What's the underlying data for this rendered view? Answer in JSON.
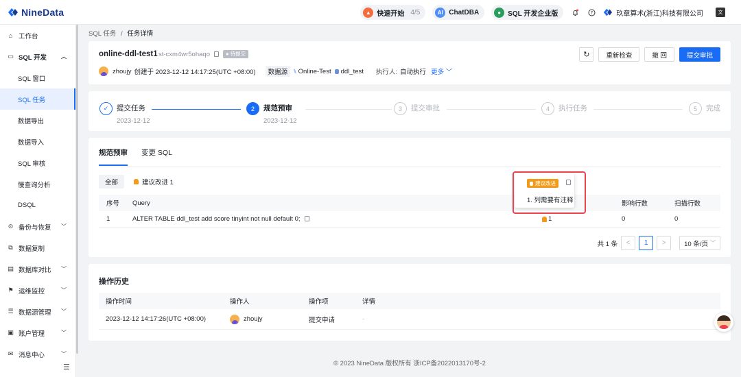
{
  "brand": {
    "name": "NineData"
  },
  "topbar": {
    "quick_start": {
      "label": "快速开始",
      "progress": "4/5"
    },
    "chatdba": {
      "label": "ChatDBA"
    },
    "edition": {
      "label": "SQL 开发企业版"
    },
    "company": "玖章算术(浙江)科技有限公司"
  },
  "sidebar": {
    "items": [
      {
        "label": "工作台",
        "icon": "home-icon"
      },
      {
        "label": "SQL 开发",
        "icon": "sql-dev-icon",
        "expanded": true
      },
      {
        "label": "SQL 窗口"
      },
      {
        "label": "SQL 任务",
        "active": true
      },
      {
        "label": "数据导出"
      },
      {
        "label": "数据导入"
      },
      {
        "label": "SQL 审核"
      },
      {
        "label": "慢查询分析"
      },
      {
        "label": "DSQL"
      },
      {
        "label": "备份与恢复",
        "icon": "backup-icon"
      },
      {
        "label": "数据复制",
        "icon": "replication-icon"
      },
      {
        "label": "数据库对比",
        "icon": "compare-icon"
      },
      {
        "label": "运维监控",
        "icon": "monitor-icon"
      },
      {
        "label": "数据源管理",
        "icon": "datasource-icon"
      },
      {
        "label": "账户管理",
        "icon": "account-icon"
      },
      {
        "label": "消息中心",
        "icon": "message-icon"
      }
    ]
  },
  "breadcrumb": {
    "parent": "SQL 任务",
    "sep": "/",
    "current": "任务详情"
  },
  "task": {
    "title": "online-ddl-test1",
    "id": "st-cxm4wr5ohaqo",
    "status": "待提交",
    "creator": "zhoujy",
    "created_text": "创建于 2023-12-12 14:17:25(UTC +08:00)",
    "datasource_label": "数据源",
    "datasource": "Online-Test",
    "database": "ddl_test",
    "executor_label": "执行人:",
    "executor": "自动执行",
    "more": "更多"
  },
  "actions": {
    "recheck": "重新检查",
    "revoke": "撤 回",
    "submit": "提交审批"
  },
  "steps": [
    {
      "num": "✓",
      "title": "提交任务",
      "date": "2023-12-12",
      "state": "done"
    },
    {
      "num": "2",
      "title": "规范预审",
      "date": "2023-12-12",
      "state": "current"
    },
    {
      "num": "3",
      "title": "提交审批",
      "date": "",
      "state": "pending"
    },
    {
      "num": "4",
      "title": "执行任务",
      "date": "",
      "state": "pending"
    },
    {
      "num": "5",
      "title": "完成",
      "date": "",
      "state": "pending"
    }
  ],
  "review": {
    "tabs": [
      "规范预审",
      "变更 SQL"
    ],
    "filter_all": "全部",
    "filter_suggest": "建议改进 1",
    "columns": {
      "no": "序号",
      "query": "Query",
      "affected": "影响行数",
      "scanned": "扫描行数"
    },
    "rows": [
      {
        "no": "1",
        "query": "ALTER TABLE ddl_test add score tinyint not null default 0;",
        "issues": "1",
        "affected": "0",
        "scanned": "0"
      }
    ],
    "tooltip": {
      "tag": "建议改进",
      "text": "1. 列需要有注释"
    },
    "pager": {
      "total": "共 1 条",
      "prev": "<",
      "page": "1",
      "next": ">",
      "size": "10 条/页"
    }
  },
  "history": {
    "title": "操作历史",
    "columns": {
      "time": "操作时间",
      "operator": "操作人",
      "action": "操作项",
      "detail": "详情"
    },
    "rows": [
      {
        "time": "2023-12-12 14:17:26(UTC +08:00)",
        "operator": "zhoujy",
        "action": "提交申请",
        "detail": "-"
      }
    ]
  },
  "footer": "© 2023 NineData 版权所有    浙ICP备2022013170号-2",
  "colors": {
    "primary": "#1a6cf5",
    "warn": "#f29a1a",
    "highlight": "#e8434e"
  }
}
